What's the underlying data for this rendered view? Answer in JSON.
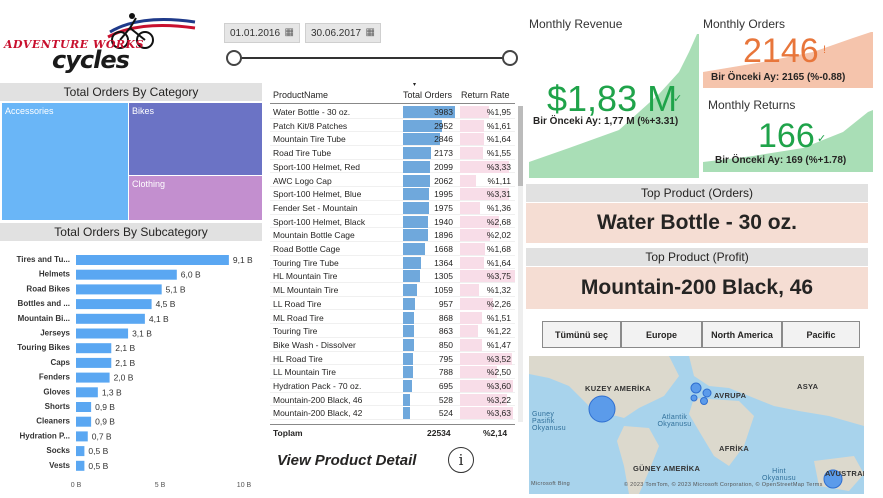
{
  "logo": {
    "line1": "ADVENTURE WORKS",
    "line2": "cycles"
  },
  "date_slicer": {
    "start": "01.01.2016",
    "end": "30.06.2017",
    "calendar_icon": "calendar-icon"
  },
  "treemap": {
    "title": "Total Orders By Category",
    "items": [
      {
        "label": "Accessories",
        "color": "#6ab6f7"
      },
      {
        "label": "Bikes",
        "color": "#6b73c5"
      },
      {
        "label": "Clothing",
        "color": "#c38fcf"
      }
    ]
  },
  "subcategory": {
    "title": "Total Orders By Subcategory",
    "axis_ticks": [
      "0 B",
      "5 B",
      "10 B"
    ]
  },
  "chart_data": {
    "type": "bar",
    "orientation": "horizontal",
    "title": "Total Orders By Subcategory",
    "categories": [
      "Tires and Tu...",
      "Helmets",
      "Road Bikes",
      "Bottles and ...",
      "Mountain Bi...",
      "Jerseys",
      "Touring Bikes",
      "Caps",
      "Fenders",
      "Gloves",
      "Shorts",
      "Cleaners",
      "Hydration P...",
      "Socks",
      "Vests"
    ],
    "values": [
      9.1,
      6.0,
      5.1,
      4.5,
      4.1,
      3.1,
      2.1,
      2.1,
      2.0,
      1.3,
      0.9,
      0.9,
      0.7,
      0.5,
      0.5
    ],
    "value_labels": [
      "9,1 B",
      "6,0 B",
      "5,1 B",
      "4,5 B",
      "4,1 B",
      "3,1 B",
      "2,1 B",
      "2,1 B",
      "2,0 B",
      "1,3 B",
      "0,9 B",
      "0,9 B",
      "0,7 B",
      "0,5 B",
      "0,5 B"
    ],
    "xlim": [
      0,
      10
    ],
    "bar_color": "#5aa7f2",
    "grid": false
  },
  "product_table": {
    "headers": {
      "name": "ProductName",
      "orders": "Total Orders",
      "return_rate": "Return Rate"
    },
    "sort_indicator": "sort-desc-icon",
    "rows": [
      {
        "name": "Water Bottle - 30 oz.",
        "orders": 3983,
        "orders_label": "3983",
        "rate": "%1,95"
      },
      {
        "name": "Patch Kit/8 Patches",
        "orders": 2952,
        "orders_label": "2952",
        "rate": "%1,61"
      },
      {
        "name": "Mountain Tire Tube",
        "orders": 2846,
        "orders_label": "2846",
        "rate": "%1,64"
      },
      {
        "name": "Road Tire Tube",
        "orders": 2173,
        "orders_label": "2173",
        "rate": "%1,55"
      },
      {
        "name": "Sport-100 Helmet, Red",
        "orders": 2099,
        "orders_label": "2099",
        "rate": "%3,33"
      },
      {
        "name": "AWC Logo Cap",
        "orders": 2062,
        "orders_label": "2062",
        "rate": "%1,11"
      },
      {
        "name": "Sport-100 Helmet, Blue",
        "orders": 1995,
        "orders_label": "1995",
        "rate": "%3,31"
      },
      {
        "name": "Fender Set - Mountain",
        "orders": 1975,
        "orders_label": "1975",
        "rate": "%1,36"
      },
      {
        "name": "Sport-100 Helmet, Black",
        "orders": 1940,
        "orders_label": "1940",
        "rate": "%2,68"
      },
      {
        "name": "Mountain Bottle Cage",
        "orders": 1896,
        "orders_label": "1896",
        "rate": "%2,02"
      },
      {
        "name": "Road Bottle Cage",
        "orders": 1668,
        "orders_label": "1668",
        "rate": "%1,68"
      },
      {
        "name": "Touring Tire Tube",
        "orders": 1364,
        "orders_label": "1364",
        "rate": "%1,64"
      },
      {
        "name": "HL Mountain Tire",
        "orders": 1305,
        "orders_label": "1305",
        "rate": "%3,75"
      },
      {
        "name": "ML Mountain Tire",
        "orders": 1059,
        "orders_label": "1059",
        "rate": "%1,32"
      },
      {
        "name": "LL Road Tire",
        "orders": 957,
        "orders_label": "957",
        "rate": "%2,26"
      },
      {
        "name": "ML Road Tire",
        "orders": 868,
        "orders_label": "868",
        "rate": "%1,51"
      },
      {
        "name": "Touring Tire",
        "orders": 863,
        "orders_label": "863",
        "rate": "%1,22"
      },
      {
        "name": "Bike Wash - Dissolver",
        "orders": 850,
        "orders_label": "850",
        "rate": "%1,47"
      },
      {
        "name": "HL Road Tire",
        "orders": 795,
        "orders_label": "795",
        "rate": "%3,52"
      },
      {
        "name": "LL Mountain Tire",
        "orders": 788,
        "orders_label": "788",
        "rate": "%2,50"
      },
      {
        "name": "Hydration Pack - 70 oz.",
        "orders": 695,
        "orders_label": "695",
        "rate": "%3,60"
      },
      {
        "name": "Mountain-200 Black, 46",
        "orders": 528,
        "orders_label": "528",
        "rate": "%3,22"
      },
      {
        "name": "Mountain-200 Black, 42",
        "orders": 524,
        "orders_label": "524",
        "rate": "%3,63"
      }
    ],
    "total": {
      "label": "Toplam",
      "orders": "22534",
      "rate": "%2,14"
    }
  },
  "view_detail": {
    "label": "View Product Detail",
    "icon": "info-icon"
  },
  "kpis": {
    "revenue": {
      "label": "Monthly Revenue",
      "value": "$1,83 M",
      "sub": "Bir Önceki Ay: 1,77 M (%+3.31)",
      "color": "#1fa34a"
    },
    "orders": {
      "label": "Monthly Orders",
      "value": "2146",
      "sub": "Bir Önceki Ay: 2165 (%-0.88)",
      "color": "#e8763b"
    },
    "returns": {
      "label": "Monthly Returns",
      "value": "166",
      "sub": "Bir Önceki Ay: 169 (%+1.78)",
      "color": "#1fa34a"
    }
  },
  "top_product_orders": {
    "title": "Top Product (Orders)",
    "value": "Water Bottle - 30 oz."
  },
  "top_product_profit": {
    "title": "Top Product (Profit)",
    "value": "Mountain-200 Black, 46"
  },
  "regions": {
    "buttons": [
      "Tümünü seç",
      "Europe",
      "North America",
      "Pacific"
    ]
  },
  "map": {
    "labels": [
      "KUZEY AMERİKA",
      "AVRUPA",
      "ASYA",
      "AFRİKA",
      "GÜNEY AMERİKA",
      "AVUSTRALYA"
    ],
    "sea_labels": [
      "Guney Pasifik Okyanusu",
      "Atlantik Okyanusu",
      "Hint Okyanusu"
    ],
    "attribution": "© 2023 TomTom, © 2023 Microsoft Corporation, © OpenStreetMap Terms",
    "brand": "Microsoft Bing"
  }
}
